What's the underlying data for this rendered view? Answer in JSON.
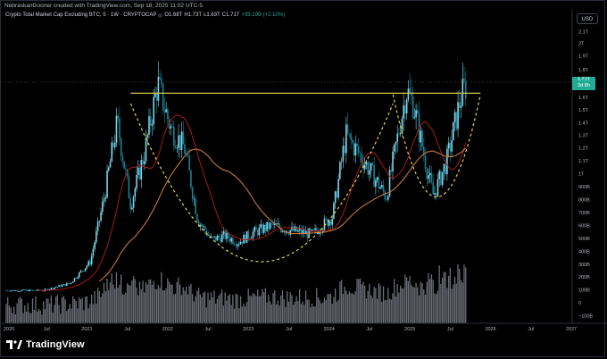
{
  "header": {
    "credit": "NebraskanGooner created with TradingView.com, Sep 18, 2025 11:02 UTC-5",
    "symbol": "Crypto Total Market Cap Excluding BTC, 5 · 1W · CRYPTOCAP",
    "open": "O1.68T",
    "high": "H1.73T",
    "low": "L1.63T",
    "close": "C1.71T",
    "change": "+35.19B (+2.10%)"
  },
  "currency_label": "USD",
  "last_price": {
    "value": "1.71T",
    "countdown": "3d 8h"
  },
  "brand": {
    "name": "TradingView",
    "icon": "tradingview-logo-icon"
  },
  "colors": {
    "up": "#26a69a",
    "down": "#ef5350",
    "price_line": "#42a5f5",
    "resistance": "#d4c84a",
    "curve": "#e6d64a",
    "ma_fast": "#b71c1c",
    "ma_slow": "#c7763a",
    "volume": "#8e929c"
  },
  "chart_data": {
    "type": "line",
    "title": "Crypto Total Market Cap Excluding BTC, 5 · 1W · CRYPTOCAP",
    "y_scale": "log",
    "price_ticks": [
      "2.1T",
      "2T",
      "1.9T",
      "1.8T",
      "1.6T",
      "1.5T",
      "1.4T",
      "1.3T",
      "1.2T",
      "1.1T",
      "1T",
      "900B",
      "800B",
      "700B",
      "600B",
      "500B",
      "400B",
      "300B",
      "200B",
      "100B",
      "0",
      "−100B"
    ],
    "x_ticks": [
      "2020",
      "Jul",
      "2021",
      "Jul",
      "2022",
      "Jul",
      "2023",
      "Jul",
      "2024",
      "Jul",
      "2025",
      "Jul",
      "2026",
      "Jul",
      "2027"
    ],
    "x": [
      "2020-06",
      "2020-10",
      "2021-01",
      "2021-03",
      "2021-05",
      "2021-07",
      "2021-09",
      "2021-11",
      "2022-01",
      "2022-03",
      "2022-05",
      "2022-07",
      "2022-09",
      "2022-11",
      "2023-01",
      "2023-04",
      "2023-07",
      "2023-10",
      "2024-01",
      "2024-03",
      "2024-05",
      "2024-07",
      "2024-09",
      "2024-12",
      "2025-01",
      "2025-03",
      "2025-04",
      "2025-06",
      "2025-08",
      "2025-09"
    ],
    "series": [
      {
        "name": "",
        "values": [
          95,
          150,
          320,
          800,
          1400,
          760,
          1150,
          1700,
          1350,
          1200,
          640,
          490,
          520,
          470,
          540,
          600,
          560,
          530,
          670,
          1300,
          1150,
          990,
          820,
          1650,
          1550,
          1050,
          830,
          1100,
          1580,
          1710
        ]
      }
    ],
    "annotations": [
      {
        "type": "horizontal_line",
        "label": "resistance",
        "y": 1630,
        "x_start": "2021-07",
        "x_end": "2025-11"
      },
      {
        "type": "curve",
        "label": "cup",
        "x_start": "2021-07",
        "x_end": "2024-10",
        "low": 320
      },
      {
        "type": "curve",
        "label": "handle",
        "x_start": "2024-10",
        "x_end": "2025-11",
        "low": 820
      }
    ],
    "grid": false
  }
}
